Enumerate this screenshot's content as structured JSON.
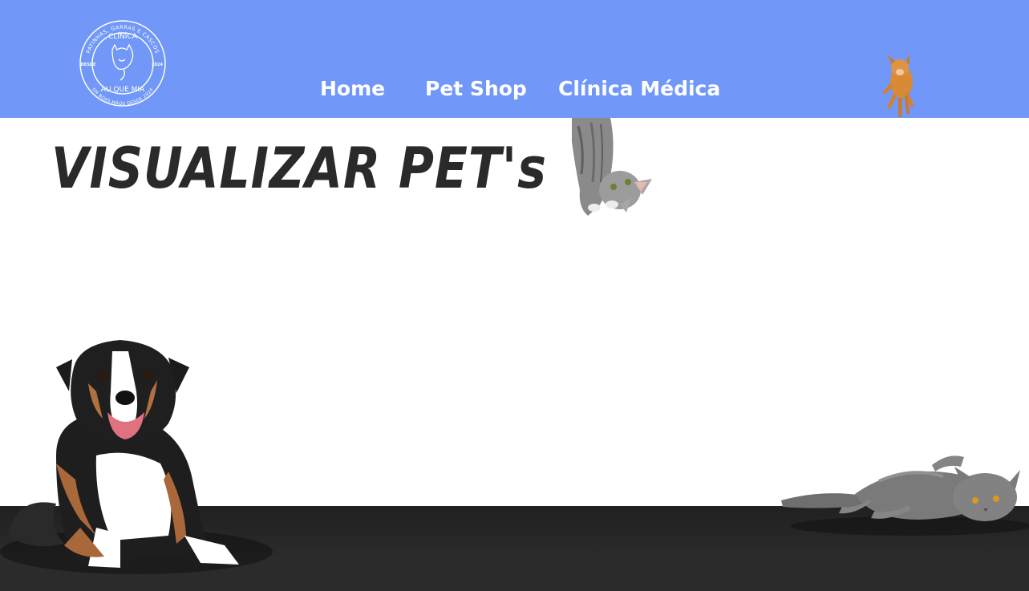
{
  "brand": {
    "ring_top": "PATINHAS, GARRAS E CASCOS",
    "name": "CLÍNICA",
    "name2": "AU QUE MIA",
    "left": "DESDE",
    "right": "2024",
    "ring_bottom": "EM BOAS MÃOS DESDE 2024"
  },
  "nav": {
    "home": "Home",
    "pet_shop": "Pet Shop",
    "clinica": "Clínica Médica"
  },
  "page": {
    "title": "VISUALIZAR PET's"
  },
  "colors": {
    "header": "#7198f8",
    "floor": "#2c2b2c",
    "title": "#2b2a2b"
  }
}
